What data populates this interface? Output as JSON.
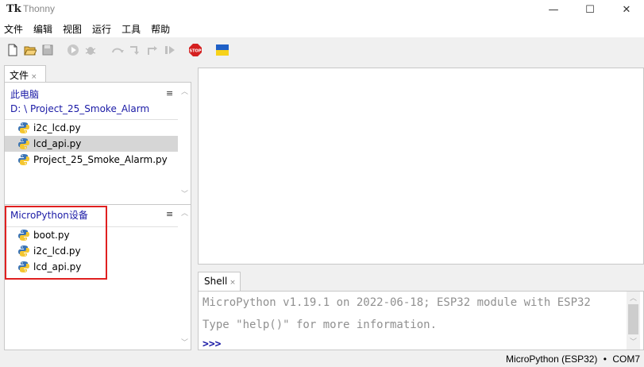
{
  "window": {
    "title": "Thonny",
    "app_icon_text": "Tk",
    "min": "—",
    "max": "☐",
    "close": "✕"
  },
  "menu": [
    "文件",
    "编辑",
    "视图",
    "运行",
    "工具",
    "帮助"
  ],
  "toolbar": {
    "stop_label": "STOP"
  },
  "files": {
    "tab_label": "文件",
    "tab_close": "×",
    "local": {
      "header": "此电脑",
      "path": "D: \\ Project_25_Smoke_Alarm",
      "menu_glyph": "≡",
      "items": [
        {
          "name": "i2c_lcd.py",
          "selected": false
        },
        {
          "name": "lcd_api.py",
          "selected": true
        },
        {
          "name": "Project_25_Smoke_Alarm.py",
          "selected": false
        }
      ]
    },
    "device": {
      "header": "MicroPython设备",
      "menu_glyph": "≡",
      "items": [
        {
          "name": "boot.py"
        },
        {
          "name": "i2c_lcd.py"
        },
        {
          "name": "lcd_api.py"
        }
      ]
    },
    "highlight_color": "#e02020"
  },
  "shell": {
    "tab_label": "Shell",
    "tab_close": "×",
    "lines": [
      "MicroPython v1.19.1 on 2022-06-18; ESP32 module with ESP32",
      "Type \"help()\" for more information."
    ],
    "prompt": ">>>"
  },
  "status": {
    "interpreter": "MicroPython (ESP32)",
    "sep": "•",
    "port": "COM7"
  },
  "colors": {
    "accent_blue": "#1a1aa6",
    "selection": "#d6d6d6"
  }
}
